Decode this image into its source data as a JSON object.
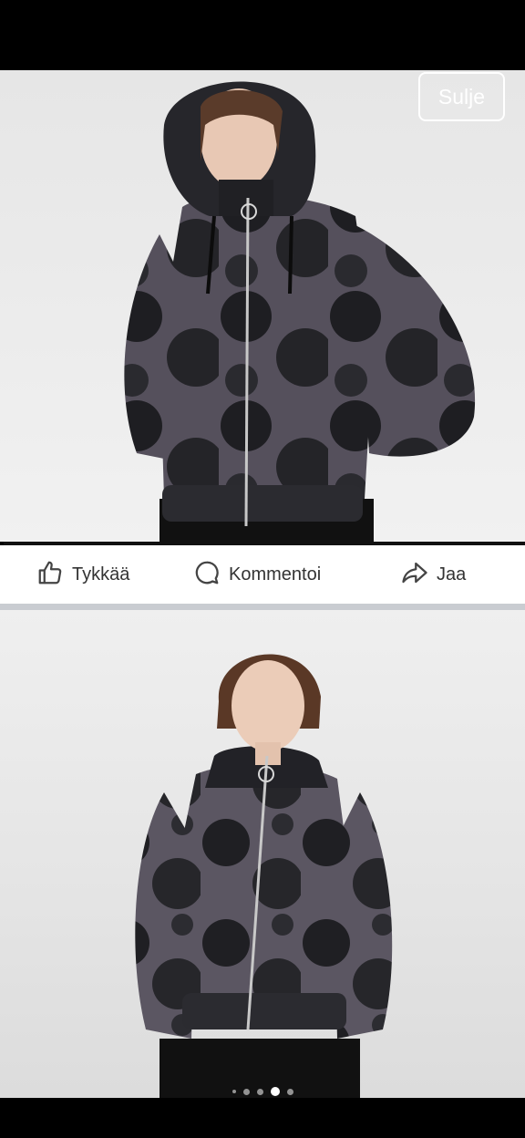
{
  "viewer": {
    "close_label": "Sulje"
  },
  "actions": {
    "like_label": "Tykkää",
    "comment_label": "Kommentoi",
    "share_label": "Jaa"
  },
  "carousel": {
    "total": 5,
    "active_index": 3
  },
  "colors": {
    "jacket_dark": "#1f1f23",
    "jacket_print": "#5a5560",
    "background": "#000000",
    "action_bar": "#ffffff",
    "separator": "#c9ccd1"
  },
  "icons": {
    "like": "thumbs-up-icon",
    "comment": "comment-bubble-icon",
    "share": "share-arrow-icon"
  }
}
